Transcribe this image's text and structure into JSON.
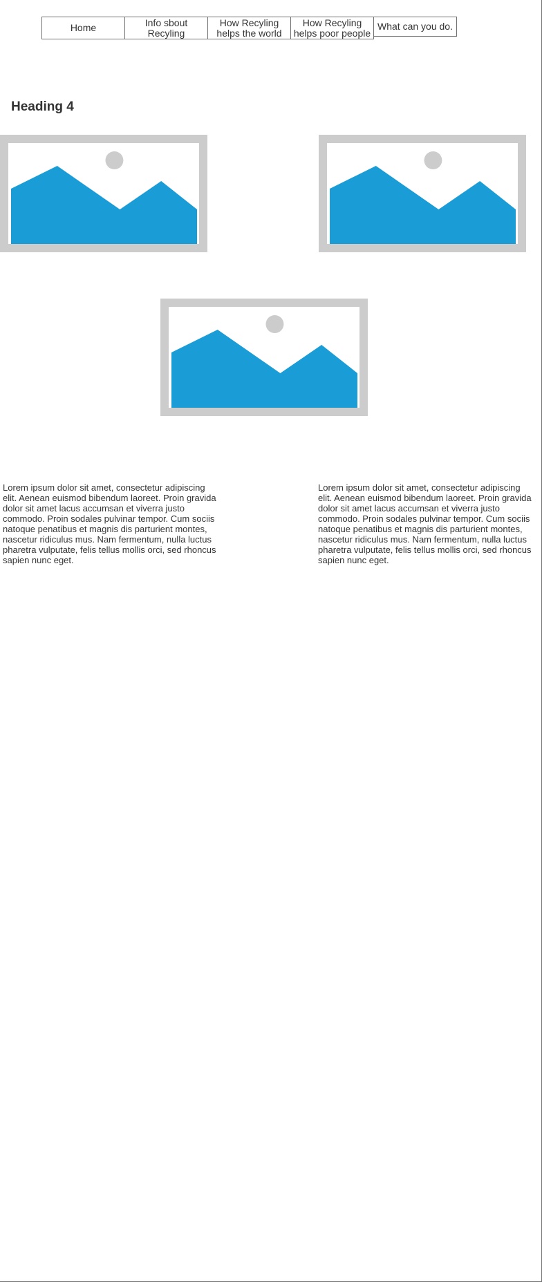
{
  "nav": {
    "items": [
      {
        "label": "Home"
      },
      {
        "label": "Info sbout Recyling"
      },
      {
        "label": "How Recyling helps the world"
      },
      {
        "label": "How Recyling helps poor people"
      },
      {
        "label": "What can you do."
      }
    ]
  },
  "heading": "Heading 4",
  "images": [
    {
      "icon": "image-placeholder-icon"
    },
    {
      "icon": "image-placeholder-icon"
    },
    {
      "icon": "image-placeholder-icon"
    }
  ],
  "paragraphs": [
    "Lorem ipsum dolor sit amet, consectetur adipiscing elit. Aenean euismod bibendum laoreet. Proin gravida dolor sit amet lacus accumsan et viverra justo commodo. Proin sodales pulvinar tempor. Cum sociis natoque penatibus et magnis dis parturient montes, nascetur ridiculus mus. Nam fermentum, nulla luctus pharetra vulputate, felis tellus mollis orci, sed rhoncus sapien nunc eget.",
    "Lorem ipsum dolor sit amet, consectetur adipiscing elit. Aenean euismod bibendum laoreet. Proin gravida dolor sit amet lacus accumsan et viverra justo commodo. Proin sodales pulvinar tempor. Cum sociis natoque penatibus et magnis dis parturient montes, nascetur ridiculus mus. Nam fermentum, nulla luctus pharetra vulputate, felis tellus mollis orci, sed rhoncus sapien nunc eget."
  ],
  "colors": {
    "placeholder_frame": "#cccccc",
    "placeholder_mountain": "#1a9cd6",
    "placeholder_sun": "#cccccc",
    "text": "#333333",
    "border": "#6f6f6f"
  }
}
